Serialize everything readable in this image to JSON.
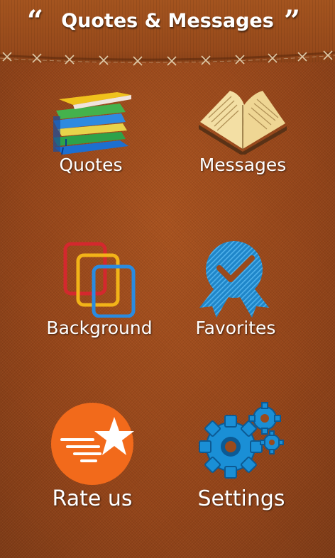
{
  "header": {
    "title": "Quotes & Messages",
    "open_quote": "“",
    "close_quote": "”"
  },
  "menu": {
    "items": [
      {
        "id": "quotes",
        "label": "Quotes",
        "icon": "books-stack-icon"
      },
      {
        "id": "messages",
        "label": "Messages",
        "icon": "open-book-icon"
      },
      {
        "id": "background",
        "label": "Background",
        "icon": "stacked-frames-icon"
      },
      {
        "id": "favorites",
        "label": "Favorites",
        "icon": "award-ribbon-icon"
      },
      {
        "id": "rate",
        "label": "Rate us",
        "icon": "star-badge-icon"
      },
      {
        "id": "settings",
        "label": "Settings",
        "icon": "gears-icon"
      }
    ]
  },
  "colors": {
    "background": "#9a4a1c",
    "label": "#ffffff",
    "favorites_blue": "#1f86c9",
    "rate_orange": "#f26a1b",
    "settings_blue": "#1a8fd6"
  }
}
